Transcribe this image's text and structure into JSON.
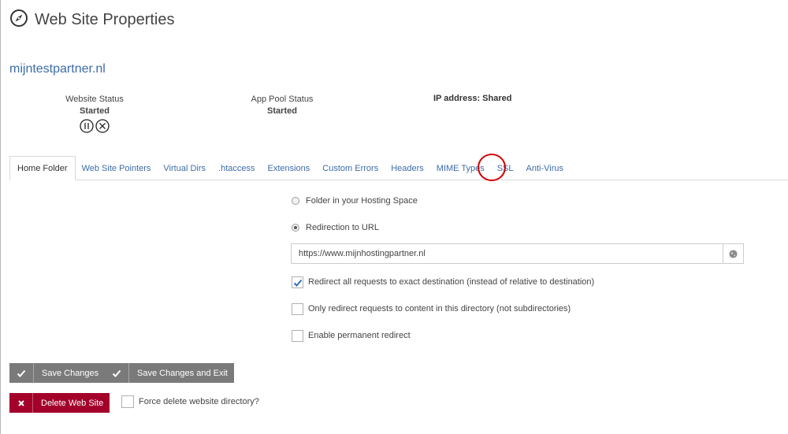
{
  "page": {
    "title": "Web Site Properties",
    "icon": "compass-icon",
    "site_name": "mijntestpartner.nl"
  },
  "status": {
    "website": {
      "label": "Website Status",
      "value": "Started"
    },
    "app_pool": {
      "label": "App Pool Status",
      "value": "Started"
    },
    "ip_address": "IP address: Shared",
    "controls": [
      "pause-icon",
      "stop-icon"
    ]
  },
  "tabs": [
    {
      "label": "Home Folder",
      "active": true
    },
    {
      "label": "Web Site Pointers",
      "active": false
    },
    {
      "label": "Virtual Dirs",
      "active": false
    },
    {
      "label": ".htaccess",
      "active": false
    },
    {
      "label": "Extensions",
      "active": false
    },
    {
      "label": "Custom Errors",
      "active": false
    },
    {
      "label": "Headers",
      "active": false
    },
    {
      "label": "MIME Types",
      "active": false
    },
    {
      "label": "SSL",
      "active": false,
      "highlighted": true
    },
    {
      "label": "Anti-Virus",
      "active": false
    }
  ],
  "home_folder": {
    "option_folder": {
      "label": "Folder in your Hosting Space",
      "selected": false
    },
    "option_redirect": {
      "label": "Redirection to URL",
      "selected": true
    },
    "redirect_url": "https://www.mijnhostingpartner.nl",
    "url_addon_icon": "globe-icon",
    "checks": {
      "exact": {
        "label": "Redirect all requests to exact destination (instead of relative to destination)",
        "checked": true
      },
      "dir_only": {
        "label": "Only redirect requests to content in this directory (not subdirectories)",
        "checked": false
      },
      "permanent": {
        "label": "Enable permanent redirect",
        "checked": false
      }
    }
  },
  "actions": {
    "save": "Save Changes",
    "save_exit": "Save Changes and Exit",
    "delete": "Delete Web Site",
    "force_delete": "Force delete website directory?"
  },
  "colors": {
    "link": "#3d6ca8",
    "button_gray": "#7a7a7a",
    "button_danger": "#a3002a",
    "highlight_circle": "#d40000"
  }
}
